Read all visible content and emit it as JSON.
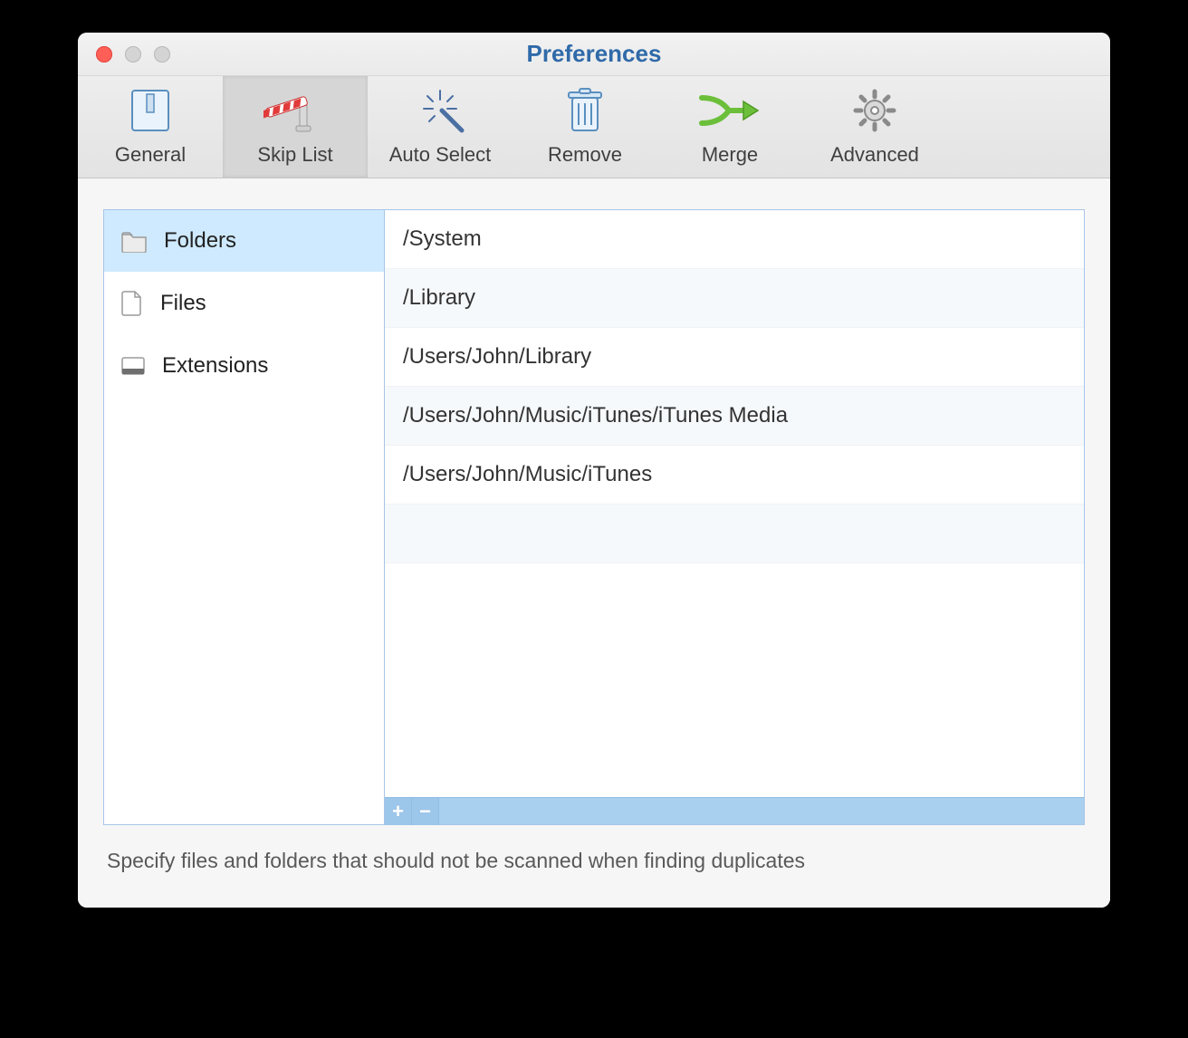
{
  "window": {
    "title": "Preferences"
  },
  "toolbar": {
    "items": [
      {
        "id": "general",
        "label": "General"
      },
      {
        "id": "skip-list",
        "label": "Skip List"
      },
      {
        "id": "auto-select",
        "label": "Auto Select"
      },
      {
        "id": "remove",
        "label": "Remove"
      },
      {
        "id": "merge",
        "label": "Merge"
      },
      {
        "id": "advanced",
        "label": "Advanced"
      }
    ],
    "selected": "skip-list"
  },
  "sidebar": {
    "items": [
      {
        "id": "folders",
        "label": "Folders"
      },
      {
        "id": "files",
        "label": "Files"
      },
      {
        "id": "extensions",
        "label": "Extensions"
      }
    ],
    "selected": "folders"
  },
  "skip_list": {
    "paths": [
      "/System",
      "/Library",
      "/Users/John/Library",
      "/Users/John/Music/iTunes/iTunes Media",
      "/Users/John/Music/iTunes"
    ]
  },
  "footer": {
    "add_label": "+",
    "remove_label": "−"
  },
  "description": "Specify files and folders that should not be scanned when finding duplicates"
}
